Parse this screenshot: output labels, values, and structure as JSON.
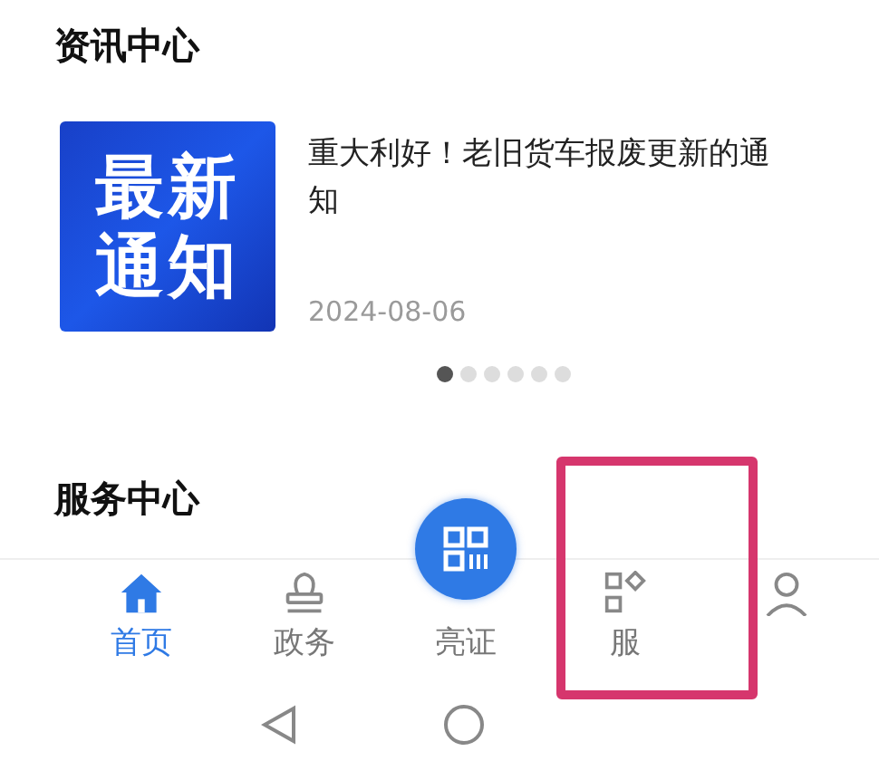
{
  "news": {
    "title": "资讯中心",
    "item": {
      "thumb_lines": [
        "最新",
        "通知"
      ],
      "title": "重大利好！老旧货车报废更新的通知",
      "date": "2024-08-06"
    },
    "dots": [
      {
        "selected": true
      },
      {
        "selected": false
      },
      {
        "selected": false
      },
      {
        "selected": false
      },
      {
        "selected": false
      },
      {
        "selected": false
      }
    ]
  },
  "services": {
    "title": "服务中心"
  },
  "tab_bar": [
    {
      "kind": "home",
      "label": "首页",
      "selected": true
    },
    {
      "kind": "stamp",
      "label": "政务",
      "selected": false
    },
    {
      "kind": "qr",
      "label": "亮证",
      "selected": false
    },
    {
      "kind": "apps",
      "label": "服",
      "selected": false,
      "highlighted": true
    },
    {
      "kind": "person",
      "selected": false
    }
  ]
}
